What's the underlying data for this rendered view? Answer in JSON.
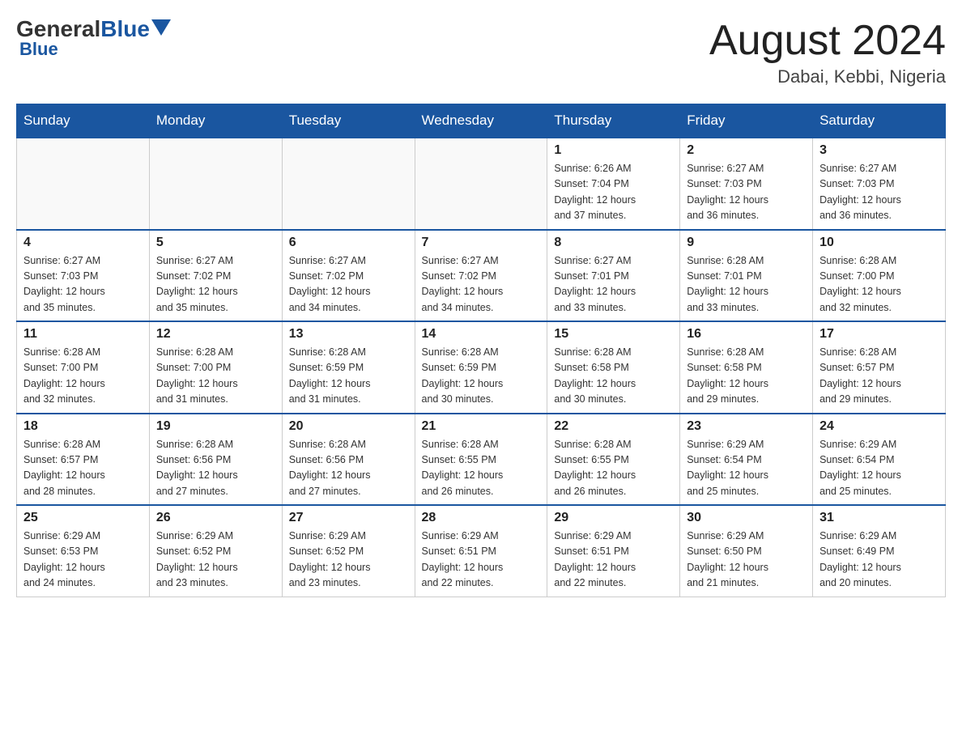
{
  "header": {
    "logo_general": "General",
    "logo_blue": "Blue",
    "month_title": "August 2024",
    "location": "Dabai, Kebbi, Nigeria"
  },
  "weekdays": [
    "Sunday",
    "Monday",
    "Tuesday",
    "Wednesday",
    "Thursday",
    "Friday",
    "Saturday"
  ],
  "weeks": [
    [
      {
        "day": "",
        "info": ""
      },
      {
        "day": "",
        "info": ""
      },
      {
        "day": "",
        "info": ""
      },
      {
        "day": "",
        "info": ""
      },
      {
        "day": "1",
        "info": "Sunrise: 6:26 AM\nSunset: 7:04 PM\nDaylight: 12 hours\nand 37 minutes."
      },
      {
        "day": "2",
        "info": "Sunrise: 6:27 AM\nSunset: 7:03 PM\nDaylight: 12 hours\nand 36 minutes."
      },
      {
        "day": "3",
        "info": "Sunrise: 6:27 AM\nSunset: 7:03 PM\nDaylight: 12 hours\nand 36 minutes."
      }
    ],
    [
      {
        "day": "4",
        "info": "Sunrise: 6:27 AM\nSunset: 7:03 PM\nDaylight: 12 hours\nand 35 minutes."
      },
      {
        "day": "5",
        "info": "Sunrise: 6:27 AM\nSunset: 7:02 PM\nDaylight: 12 hours\nand 35 minutes."
      },
      {
        "day": "6",
        "info": "Sunrise: 6:27 AM\nSunset: 7:02 PM\nDaylight: 12 hours\nand 34 minutes."
      },
      {
        "day": "7",
        "info": "Sunrise: 6:27 AM\nSunset: 7:02 PM\nDaylight: 12 hours\nand 34 minutes."
      },
      {
        "day": "8",
        "info": "Sunrise: 6:27 AM\nSunset: 7:01 PM\nDaylight: 12 hours\nand 33 minutes."
      },
      {
        "day": "9",
        "info": "Sunrise: 6:28 AM\nSunset: 7:01 PM\nDaylight: 12 hours\nand 33 minutes."
      },
      {
        "day": "10",
        "info": "Sunrise: 6:28 AM\nSunset: 7:00 PM\nDaylight: 12 hours\nand 32 minutes."
      }
    ],
    [
      {
        "day": "11",
        "info": "Sunrise: 6:28 AM\nSunset: 7:00 PM\nDaylight: 12 hours\nand 32 minutes."
      },
      {
        "day": "12",
        "info": "Sunrise: 6:28 AM\nSunset: 7:00 PM\nDaylight: 12 hours\nand 31 minutes."
      },
      {
        "day": "13",
        "info": "Sunrise: 6:28 AM\nSunset: 6:59 PM\nDaylight: 12 hours\nand 31 minutes."
      },
      {
        "day": "14",
        "info": "Sunrise: 6:28 AM\nSunset: 6:59 PM\nDaylight: 12 hours\nand 30 minutes."
      },
      {
        "day": "15",
        "info": "Sunrise: 6:28 AM\nSunset: 6:58 PM\nDaylight: 12 hours\nand 30 minutes."
      },
      {
        "day": "16",
        "info": "Sunrise: 6:28 AM\nSunset: 6:58 PM\nDaylight: 12 hours\nand 29 minutes."
      },
      {
        "day": "17",
        "info": "Sunrise: 6:28 AM\nSunset: 6:57 PM\nDaylight: 12 hours\nand 29 minutes."
      }
    ],
    [
      {
        "day": "18",
        "info": "Sunrise: 6:28 AM\nSunset: 6:57 PM\nDaylight: 12 hours\nand 28 minutes."
      },
      {
        "day": "19",
        "info": "Sunrise: 6:28 AM\nSunset: 6:56 PM\nDaylight: 12 hours\nand 27 minutes."
      },
      {
        "day": "20",
        "info": "Sunrise: 6:28 AM\nSunset: 6:56 PM\nDaylight: 12 hours\nand 27 minutes."
      },
      {
        "day": "21",
        "info": "Sunrise: 6:28 AM\nSunset: 6:55 PM\nDaylight: 12 hours\nand 26 minutes."
      },
      {
        "day": "22",
        "info": "Sunrise: 6:28 AM\nSunset: 6:55 PM\nDaylight: 12 hours\nand 26 minutes."
      },
      {
        "day": "23",
        "info": "Sunrise: 6:29 AM\nSunset: 6:54 PM\nDaylight: 12 hours\nand 25 minutes."
      },
      {
        "day": "24",
        "info": "Sunrise: 6:29 AM\nSunset: 6:54 PM\nDaylight: 12 hours\nand 25 minutes."
      }
    ],
    [
      {
        "day": "25",
        "info": "Sunrise: 6:29 AM\nSunset: 6:53 PM\nDaylight: 12 hours\nand 24 minutes."
      },
      {
        "day": "26",
        "info": "Sunrise: 6:29 AM\nSunset: 6:52 PM\nDaylight: 12 hours\nand 23 minutes."
      },
      {
        "day": "27",
        "info": "Sunrise: 6:29 AM\nSunset: 6:52 PM\nDaylight: 12 hours\nand 23 minutes."
      },
      {
        "day": "28",
        "info": "Sunrise: 6:29 AM\nSunset: 6:51 PM\nDaylight: 12 hours\nand 22 minutes."
      },
      {
        "day": "29",
        "info": "Sunrise: 6:29 AM\nSunset: 6:51 PM\nDaylight: 12 hours\nand 22 minutes."
      },
      {
        "day": "30",
        "info": "Sunrise: 6:29 AM\nSunset: 6:50 PM\nDaylight: 12 hours\nand 21 minutes."
      },
      {
        "day": "31",
        "info": "Sunrise: 6:29 AM\nSunset: 6:49 PM\nDaylight: 12 hours\nand 20 minutes."
      }
    ]
  ]
}
